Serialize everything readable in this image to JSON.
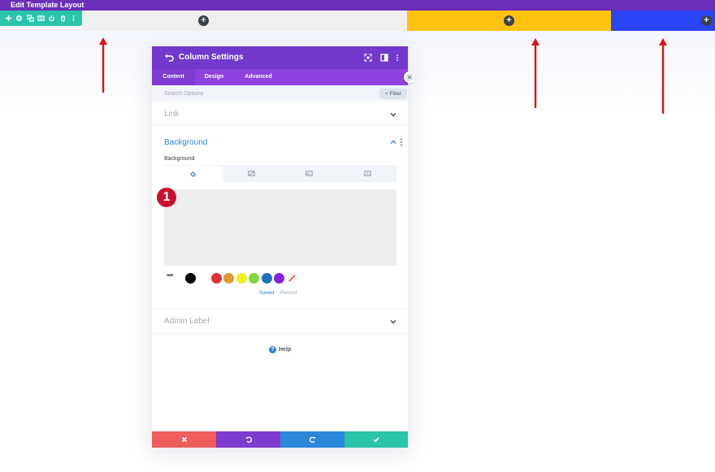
{
  "app": {
    "title": "Edit Template Layout"
  },
  "row": {
    "toolbar_icons": [
      "plus-icon",
      "gear-icon",
      "duplicate-icon",
      "columns-icon",
      "power-icon",
      "trash-icon",
      "more-icon"
    ],
    "columns": [
      {
        "background": "#efefef",
        "add_icon": "+"
      },
      {
        "background": "#ffc20e",
        "add_icon": "+"
      },
      {
        "background": "#2a45f6",
        "add_icon": "+"
      }
    ]
  },
  "modal": {
    "title": "Column Settings",
    "tabs": [
      "Content",
      "Design",
      "Advanced"
    ],
    "active_tab": "Content",
    "search_placeholder": "Search Options",
    "filter_label": "+ Filter",
    "sections": {
      "link": {
        "title": "Link",
        "expanded": false
      },
      "background": {
        "title": "Background",
        "expanded": true,
        "field_label": "Background",
        "bg_types": [
          "color",
          "gradient",
          "image",
          "video"
        ],
        "active_type": "color",
        "swatches": [
          "#000000",
          "#ffffff",
          "#dd3333",
          "#dd9933",
          "#eeee22",
          "#81d742",
          "#1e73be",
          "#8224e3"
        ],
        "palette_tabs": {
          "saved": "Saved",
          "recent": "Recent"
        }
      },
      "admin_label": {
        "title": "Admin Label",
        "expanded": false
      }
    },
    "help_label": "Help",
    "footer_buttons": [
      "cancel",
      "undo",
      "redo",
      "save"
    ]
  },
  "annotation": {
    "step_number": "1"
  },
  "colors": {
    "top_bar": "#6c2eb9",
    "modal_header": "#7238cc",
    "modal_tabs": "#8e42dd",
    "accent_blue": "#2b87da",
    "toolbar_green": "#29c4a9",
    "arrow_red": "#e01010",
    "badge_red": "#c8102e"
  }
}
